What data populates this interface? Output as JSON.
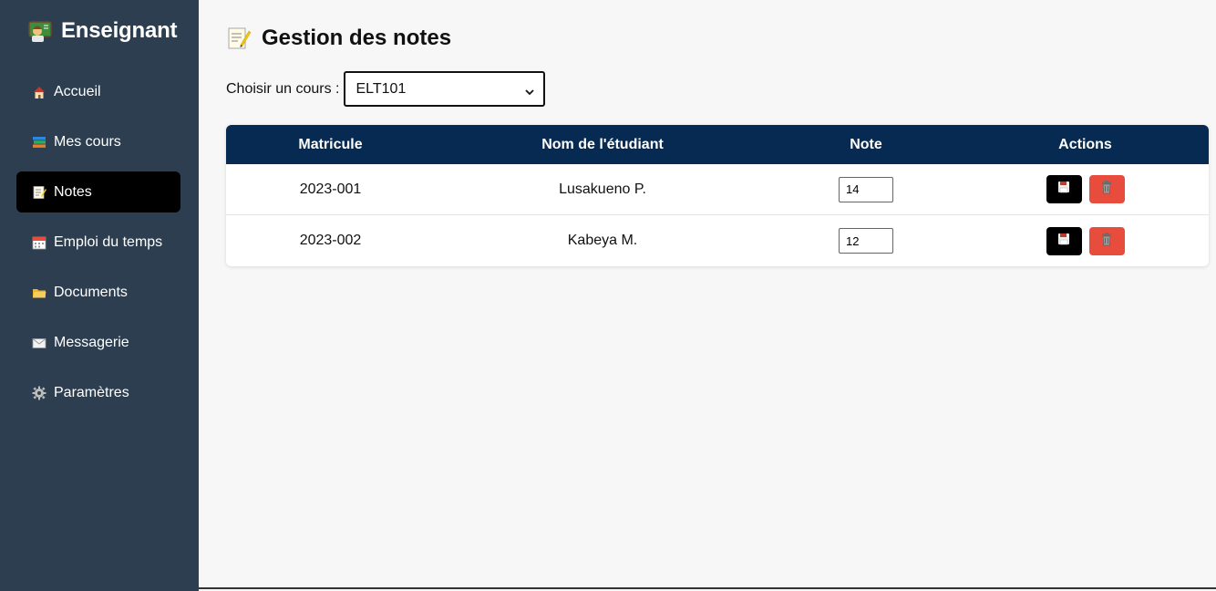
{
  "sidebar": {
    "brand": "Enseignant",
    "brand_icon": "teacher-icon",
    "items": [
      {
        "label": "Accueil",
        "icon": "home-icon",
        "active": false
      },
      {
        "label": "Mes cours",
        "icon": "books-icon",
        "active": false
      },
      {
        "label": "Notes",
        "icon": "memo-icon",
        "active": true
      },
      {
        "label": "Emploi du temps",
        "icon": "calendar-icon",
        "active": false
      },
      {
        "label": "Documents",
        "icon": "folder-icon",
        "active": false
      },
      {
        "label": "Messagerie",
        "icon": "envelope-icon",
        "active": false
      },
      {
        "label": "Paramètres",
        "icon": "gear-icon",
        "active": false
      }
    ]
  },
  "main": {
    "title": "Gestion des notes",
    "title_icon": "memo-icon",
    "course_label": "Choisir un cours :",
    "course_selected": "ELT101",
    "table": {
      "headers": [
        "Matricule",
        "Nom de l'étudiant",
        "Note",
        "Actions"
      ],
      "rows": [
        {
          "matricule": "2023-001",
          "name": "Lusakueno P.",
          "note": "14"
        },
        {
          "matricule": "2023-002",
          "name": "Kabeya M.",
          "note": "12"
        }
      ]
    }
  },
  "colors": {
    "sidebar_bg": "#2c3e50",
    "active_item": "#000000",
    "table_header": "#062a52",
    "save_button": "#000000",
    "delete_button": "#e74c3c"
  }
}
